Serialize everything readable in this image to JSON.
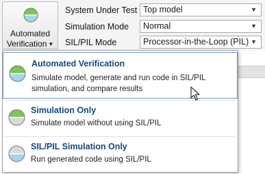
{
  "toolstrip": {
    "mode_button": {
      "label_line1": "Automated",
      "label_line2": "Verification",
      "icon": "half-green-half-blue-circle-icon",
      "caret": "▼"
    },
    "properties": [
      {
        "label": "System Under Test",
        "value": "Top model"
      },
      {
        "label": "Simulation Mode",
        "value": "Normal"
      },
      {
        "label": "SIL/PIL Mode",
        "value": "Processor-in-the-Loop (PIL)"
      }
    ]
  },
  "dropdown_menu": {
    "items": [
      {
        "title": "Automated Verification",
        "description": "Simulate model, generate and run code in SIL/PIL simulation, and compare results",
        "icon": "green-over-blue-circle-icon",
        "selected": true
      },
      {
        "title": "Simulation Only",
        "description": "Simulate model without using SIL/PIL",
        "icon": "green-over-gray-circle-icon",
        "selected": false
      },
      {
        "title": "SIL/PIL Simulation Only",
        "description": "Run generated code using SIL/PIL",
        "icon": "gray-over-blue-circle-icon",
        "selected": false
      }
    ]
  },
  "colors": {
    "title_blue": "#14487e",
    "selection_border": "#6a97c9",
    "icon_green": "#7ec45a",
    "icon_blue": "#a9d2ee",
    "icon_gray": "#d9d9d9"
  }
}
